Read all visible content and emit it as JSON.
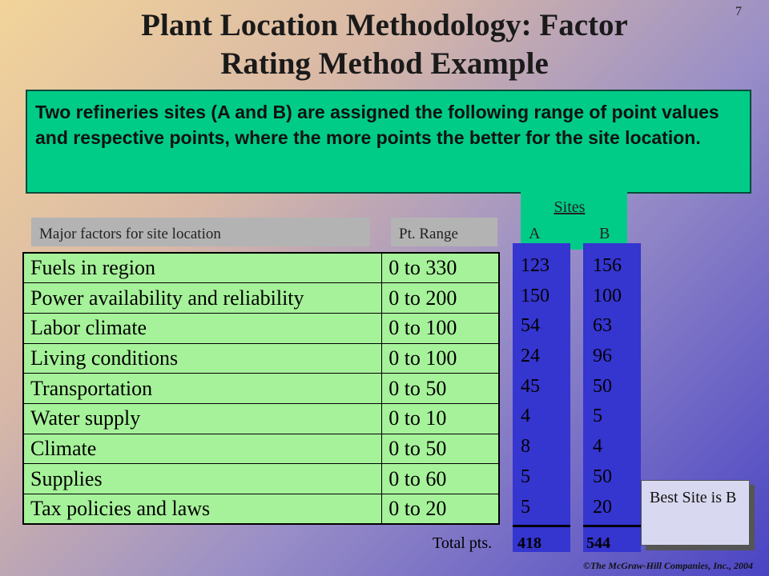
{
  "page_number": "7",
  "title_lines": [
    "Plant Location Methodology: Factor",
    "Rating Method Example"
  ],
  "intro_text": "Two refineries sites (A and B) are assigned the following range of point values and respective points, where the more points the better for the site location.",
  "headers": {
    "factors": "Major factors for site location",
    "range": "Pt. Range",
    "sites": "Sites",
    "site_a": "A",
    "site_b": "B"
  },
  "factors": [
    {
      "name": "Fuels in region",
      "range": "0 to 330"
    },
    {
      "name": "Power availability and reliability",
      "range": "0 to 200"
    },
    {
      "name": "Labor climate",
      "range": "0 to 100"
    },
    {
      "name": "Living conditions",
      "range": "0 to 100"
    },
    {
      "name": "Transportation",
      "range": "0 to 50"
    },
    {
      "name": "Water supply",
      "range": "0 to 10"
    },
    {
      "name": "Climate",
      "range": "0 to 50"
    },
    {
      "name": "Supplies",
      "range": "0 to 60"
    },
    {
      "name": "Tax policies and laws",
      "range": "0 to 20"
    }
  ],
  "site_a_scores": [
    "123",
    "150",
    "54",
    "24",
    "45",
    "4",
    "8",
    "5",
    "5"
  ],
  "site_b_scores": [
    "156",
    "100",
    "63",
    "96",
    "50",
    "5",
    "4",
    "50",
    "20"
  ],
  "totals": {
    "label": "Total pts.",
    "site_a": "418",
    "site_b": "544"
  },
  "best_site": "Best Site is B",
  "copyright": "©The McGraw-Hill Companies, Inc., 2004"
}
